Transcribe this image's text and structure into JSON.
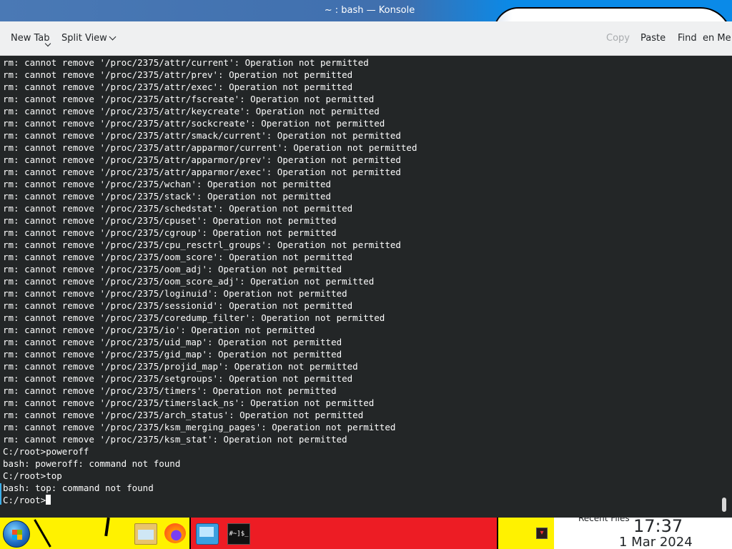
{
  "window": {
    "title": "~ : bash — Konsole"
  },
  "toolbar": {
    "new_tab": "New Tab",
    "split_view": "Split View",
    "copy": "Copy",
    "paste": "Paste",
    "find": "Find",
    "menu": "en Me"
  },
  "terminal": {
    "lines": [
      "rm: cannot remove '/proc/2375/attr/current': Operation not permitted",
      "rm: cannot remove '/proc/2375/attr/prev': Operation not permitted",
      "rm: cannot remove '/proc/2375/attr/exec': Operation not permitted",
      "rm: cannot remove '/proc/2375/attr/fscreate': Operation not permitted",
      "rm: cannot remove '/proc/2375/attr/keycreate': Operation not permitted",
      "rm: cannot remove '/proc/2375/attr/sockcreate': Operation not permitted",
      "rm: cannot remove '/proc/2375/attr/smack/current': Operation not permitted",
      "rm: cannot remove '/proc/2375/attr/apparmor/current': Operation not permitted",
      "rm: cannot remove '/proc/2375/attr/apparmor/prev': Operation not permitted",
      "rm: cannot remove '/proc/2375/attr/apparmor/exec': Operation not permitted",
      "rm: cannot remove '/proc/2375/wchan': Operation not permitted",
      "rm: cannot remove '/proc/2375/stack': Operation not permitted",
      "rm: cannot remove '/proc/2375/schedstat': Operation not permitted",
      "rm: cannot remove '/proc/2375/cpuset': Operation not permitted",
      "rm: cannot remove '/proc/2375/cgroup': Operation not permitted",
      "rm: cannot remove '/proc/2375/cpu_resctrl_groups': Operation not permitted",
      "rm: cannot remove '/proc/2375/oom_score': Operation not permitted",
      "rm: cannot remove '/proc/2375/oom_adj': Operation not permitted",
      "rm: cannot remove '/proc/2375/oom_score_adj': Operation not permitted",
      "rm: cannot remove '/proc/2375/loginuid': Operation not permitted",
      "rm: cannot remove '/proc/2375/sessionid': Operation not permitted",
      "rm: cannot remove '/proc/2375/coredump_filter': Operation not permitted",
      "rm: cannot remove '/proc/2375/io': Operation not permitted",
      "rm: cannot remove '/proc/2375/uid_map': Operation not permitted",
      "rm: cannot remove '/proc/2375/gid_map': Operation not permitted",
      "rm: cannot remove '/proc/2375/projid_map': Operation not permitted",
      "rm: cannot remove '/proc/2375/setgroups': Operation not permitted",
      "rm: cannot remove '/proc/2375/timers': Operation not permitted",
      "rm: cannot remove '/proc/2375/timerslack_ns': Operation not permitted",
      "rm: cannot remove '/proc/2375/arch_status': Operation not permitted",
      "rm: cannot remove '/proc/2375/ksm_merging_pages': Operation not permitted",
      "rm: cannot remove '/proc/2375/ksm_stat': Operation not permitted",
      "C:/root>poweroff",
      "bash: poweroff: command not found",
      "C:/root>top",
      "bash: top: command not found"
    ],
    "prompt": "C:/root>"
  },
  "taskbar": {
    "konsole_icon_text": "#~]$_",
    "recent_files": "Recent Files",
    "clock_time": "17:37",
    "clock_date": "1 Mar 2024"
  },
  "colors": {
    "terminal_bg": "#232627",
    "terminal_fg": "#fcfcfc",
    "titlebar": "#3f6fae",
    "accent": "#3daee9"
  },
  "icons": [
    "start-icon",
    "files-icon",
    "firefox-icon",
    "system-monitor-icon",
    "konsole-icon",
    "tray-icon",
    "chevron-down-icon"
  ]
}
